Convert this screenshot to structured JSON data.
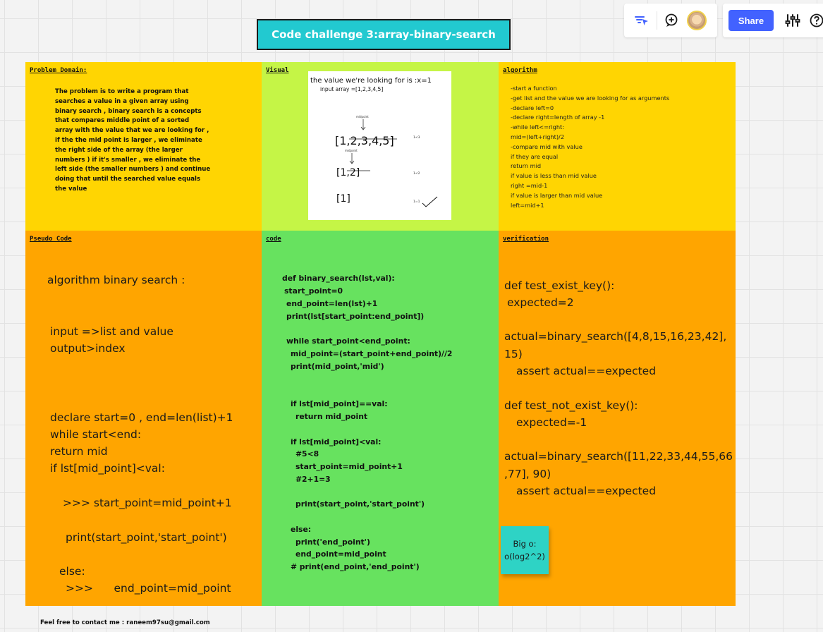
{
  "title": "Code challenge 3:array-binary-search",
  "toolbar": {
    "share_label": "Share",
    "icons": [
      "filter-cursor-icon",
      "add-comment-icon",
      "avatar",
      "settings-sliders-icon",
      "help-icon"
    ],
    "share_color": "#4262ff"
  },
  "colors": {
    "yellow": "#ffd502",
    "lime": "#c5f546",
    "orange": "#ffa500",
    "green": "#67e25f",
    "teal": "#22c9d0",
    "sticky": "#2ed3c5"
  },
  "problem": {
    "label": "Problem Domain:",
    "lines": [
      "The problem is to write a program that",
      "searches a value in a given array using",
      "binary search , binary search is a concepts",
      "that compares middle point of  a sorted",
      "array with the value that we are looking for ,",
      "if the the mid point is larger , we eliminate",
      "the right side of the array (the larger",
      "numbers ) if it's smaller , we eliminate the",
      "left side (the smaller numbers ) and continue",
      "doing that until the searched value equals",
      "the value"
    ]
  },
  "visual": {
    "label": "Visual",
    "heading": "the value we're looking for is :x=1",
    "input": "input array =[1,2,3,4,5]",
    "step1": "[1,2,3,4,5]",
    "step2": "[1,2]",
    "step3": "[1]",
    "mid_label": "midpoint",
    "notes": [
      "1<3",
      "1<2",
      "1=1"
    ]
  },
  "algorithm": {
    "label": "algorithm",
    "lines": [
      "-start a function",
      "-get list and the value we are looking for as arguments",
      "-declare left=0",
      "-declare right=length of array -1",
      "-while left<=right:",
      "mid=(left+right)/2",
      "-compare mid with value",
      "if they are equal",
      "return mid",
      "if value is less than mid value",
      "right =mid-1",
      "if value is larger than mid value",
      "left=mid+1"
    ]
  },
  "pseudo": {
    "label": "Pseudo Code",
    "lines": [
      "algorithm binary search :",
      "input =>list and value",
      "output>index",
      "declare start=0 , end=len(list)+1",
      "while start<end:",
      "return mid",
      "if lst[mid_point]<val:",
      ">>> start_point=mid_point+1",
      "print(start_point,'start_point')",
      "else:",
      ">>>      end_point=mid_point"
    ]
  },
  "code": {
    "label": "code",
    "lines": [
      "def binary_search(lst,val):",
      "start_point=0",
      "end_point=len(lst)+1",
      "print(lst[start_point:end_point])",
      "while start_point<end_point:",
      "mid_point=(start_point+end_point)//2",
      "print(mid_point,'mid')",
      "if lst[mid_point]==val:",
      "return mid_point",
      "if lst[mid_point]<val:",
      "#5<8",
      "start_point=mid_point+1",
      "#2+1=3",
      "print(start_point,'start_point')",
      "else:",
      "print('end_point')",
      "end_point=mid_point",
      "# print(end_point,'end_point')"
    ]
  },
  "verification": {
    "label": "verification",
    "lines": [
      "def test_exist_key():",
      "expected=2",
      "actual=binary_search([4,8,15,16,23,42],",
      "15)",
      "assert actual==expected",
      "def test_not_exist_key():",
      "expected=-1",
      "actual=binary_search([11,22,33,44,55,66",
      ",77], 90)",
      "assert actual==expected"
    ]
  },
  "sticky": {
    "line1": "Big o:",
    "line2": "o(log2^2)"
  },
  "footer": "Feel free to contact me : raneem97su@gmail.com"
}
